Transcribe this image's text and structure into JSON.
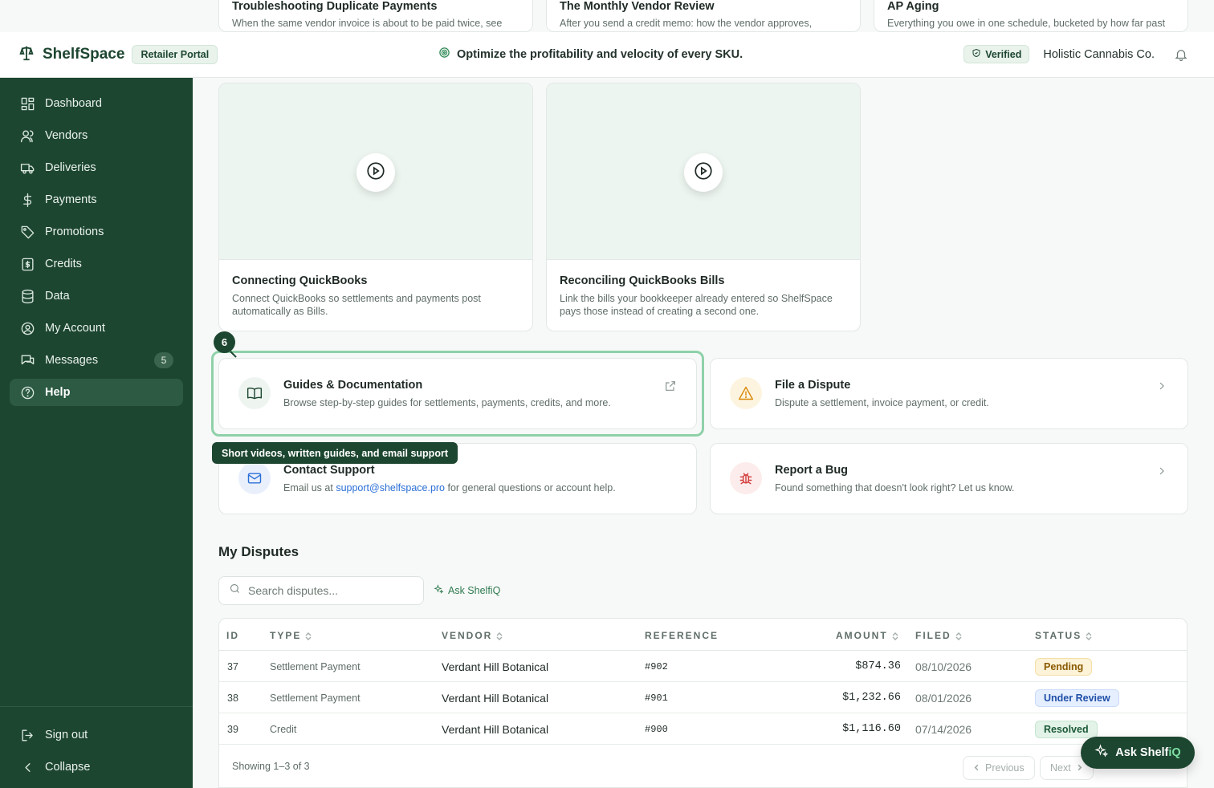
{
  "header": {
    "brand": "ShelfSpace",
    "portal": "Retailer Portal",
    "tagline": "Optimize the profitability and velocity of every SKU.",
    "verified": "Verified",
    "org": "Holistic Cannabis Co."
  },
  "sidebar": {
    "items": [
      {
        "label": "Dashboard",
        "icon": "dashboard-icon"
      },
      {
        "label": "Vendors",
        "icon": "users-icon"
      },
      {
        "label": "Deliveries",
        "icon": "truck-icon"
      },
      {
        "label": "Payments",
        "icon": "dollar-icon"
      },
      {
        "label": "Promotions",
        "icon": "tag-icon"
      },
      {
        "label": "Credits",
        "icon": "receipt-icon"
      },
      {
        "label": "Data",
        "icon": "database-icon"
      },
      {
        "label": "My Account",
        "icon": "user-circle-icon"
      },
      {
        "label": "Messages",
        "icon": "messages-icon",
        "badge": "5"
      },
      {
        "label": "Help",
        "icon": "help-icon",
        "active": true
      }
    ],
    "sign_out": "Sign out",
    "collapse": "Collapse"
  },
  "top_cards": [
    {
      "title": "Troubleshooting Duplicate Payments",
      "desc": "When the same vendor invoice is about to be paid twice, see"
    },
    {
      "title": "The Monthly Vendor Review",
      "desc": "After you send a credit memo: how the vendor approves,"
    },
    {
      "title": "AP Aging",
      "desc": "Everything you owe in one schedule, bucketed by how far past"
    }
  ],
  "video_cards": [
    {
      "title": "Connecting QuickBooks",
      "desc": "Connect QuickBooks so settlements and payments post automatically as Bills."
    },
    {
      "title": "Reconciling QuickBooks Bills",
      "desc": "Link the bills your bookkeeper already entered so ShelfSpace pays those instead of creating a second one."
    }
  ],
  "actions": {
    "guides": {
      "title": "Guides & Documentation",
      "desc": "Browse step-by-step guides for settlements, payments, credits, and more."
    },
    "dispute": {
      "title": "File a Dispute",
      "desc": "Dispute a settlement, invoice payment, or credit."
    },
    "support": {
      "title": "Contact Support",
      "desc_prefix": "Email us at",
      "email": "support@shelfspace.pro",
      "desc_suffix": "for general questions or account help."
    },
    "bug": {
      "title": "Report a Bug",
      "desc": "Found something that doesn't look right? Let us know."
    }
  },
  "tour": {
    "step": "6",
    "tooltip": "Short videos, written guides, and email support"
  },
  "disputes": {
    "title": "My Disputes",
    "search_placeholder": "Search disputes...",
    "ask_link": "Ask ShelfiQ",
    "columns": [
      "ID",
      "TYPE",
      "VENDOR",
      "REFERENCE",
      "AMOUNT",
      "FILED",
      "STATUS"
    ],
    "rows": [
      {
        "id": "37",
        "type": "Settlement Payment",
        "vendor": "Verdant Hill Botanical",
        "ref": "#902",
        "amount": "$874.36",
        "filed": "08/10/2026",
        "status": "Pending"
      },
      {
        "id": "38",
        "type": "Settlement Payment",
        "vendor": "Verdant Hill Botanical",
        "ref": "#901",
        "amount": "$1,232.66",
        "filed": "08/01/2026",
        "status": "Under Review"
      },
      {
        "id": "39",
        "type": "Credit",
        "vendor": "Verdant Hill Botanical",
        "ref": "#900",
        "amount": "$1,116.60",
        "filed": "07/14/2026",
        "status": "Resolved"
      }
    ],
    "showing": "Showing 1–3 of 3",
    "prev": "Previous",
    "next": "Next"
  },
  "fab": {
    "label_main": "Ask Shelf",
    "label_accent": "iQ"
  },
  "colors": {
    "brand": "#1d4630",
    "pending_bg": "#fdf3d8",
    "pending_fg": "#8a5a00",
    "review_bg": "#e6efff",
    "review_fg": "#1f4fa8",
    "resolved_bg": "#e3f3e8",
    "resolved_fg": "#1d5a38"
  }
}
